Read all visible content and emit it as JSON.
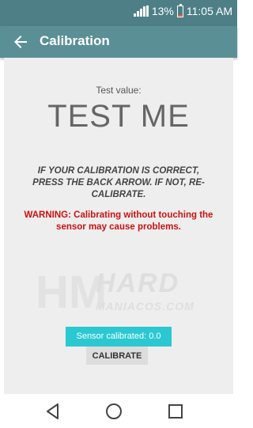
{
  "status_bar": {
    "battery_text": "13%",
    "battery_level": 0.13,
    "time": "11:05 AM",
    "icons": [
      "signal-icon",
      "battery-icon"
    ]
  },
  "app_bar": {
    "title": "Calibration",
    "back_icon": "arrow-left-icon"
  },
  "content": {
    "test_label": "Test value:",
    "test_value": "TEST ME",
    "instructions": "IF YOUR CALIBRATION IS CORRECT, PRESS THE BACK ARROW. IF NOT, RE-CALIBRATE.",
    "warning": "WARNING: Calibrating without touching the sensor may cause problems.",
    "calibrate_button": "CALIBRATE",
    "toast": "Sensor calibrated: 0.0"
  },
  "watermark": {
    "logo": "HM",
    "line1": "HARD",
    "line2": "MANIACOS.COM"
  },
  "nav_bar": {
    "icons": [
      "back-triangle-icon",
      "home-circle-icon",
      "recents-square-icon"
    ]
  },
  "colors": {
    "status_bar": "#4e7f86",
    "app_bar": "#5b8f96",
    "warning": "#cc1111",
    "toast": "#2bc8d2"
  }
}
